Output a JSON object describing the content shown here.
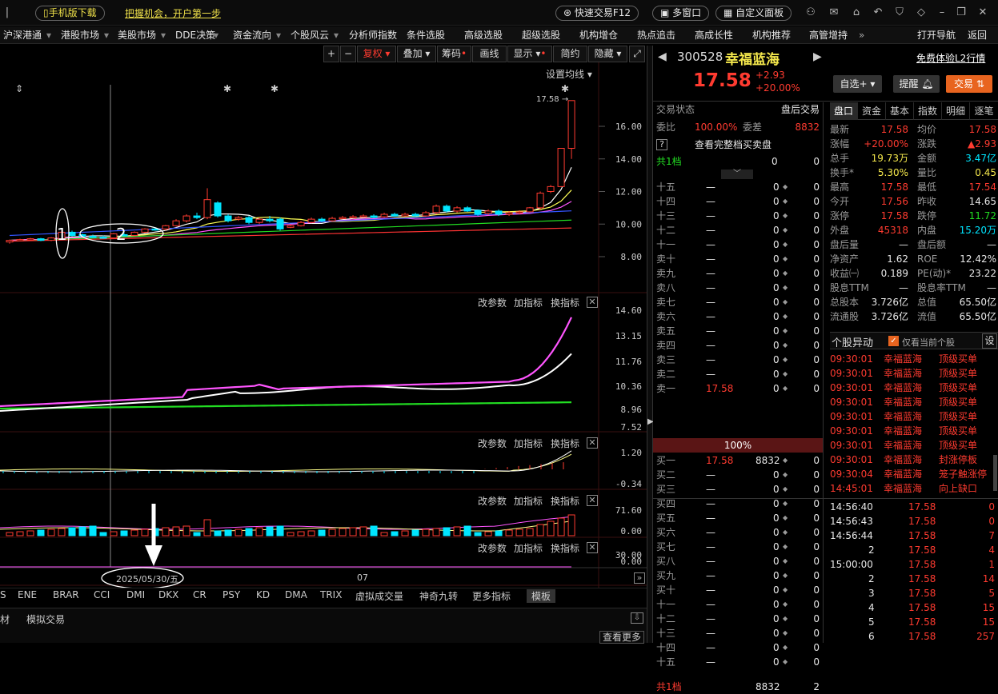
{
  "topbar": {
    "mobile": "手机版下载",
    "slogan": "把握机会，开户第一步",
    "quick_trade": "快速交易F12",
    "multi_window": "多窗口",
    "custom_panel": "自定义面板"
  },
  "menu": [
    "沪深港通",
    "港股市场",
    "美股市场",
    "DDE决策",
    "资金流向",
    "个股风云",
    "分析师指数",
    "条件选股",
    "高级选股",
    "超级选股",
    "机构增仓",
    "热点追击",
    "高成长性",
    "机构推荐",
    "高管增持"
  ],
  "menu_more": "»",
  "menu_right": [
    "打开导航",
    "返回"
  ],
  "chart_toolbar": {
    "plus": "+",
    "minus": "−",
    "fuquan": "复权",
    "overlay": "叠加",
    "chips": "筹码",
    "draw": "画线",
    "display": "显示",
    "simple": "简约",
    "hide": "隐藏"
  },
  "settings": "设置均线",
  "price_mark": "17.58",
  "annotations": {
    "one": "1",
    "two": "2"
  },
  "date_label": "2025/05/30/五",
  "month_label": "07",
  "panel_labels": {
    "params": "改参数",
    "add": "加指标",
    "switch": "换指标",
    "close": "✕"
  },
  "chart_data": [
    {
      "type": "candlestick",
      "panel": "price",
      "ylim": [
        7.5,
        17.2
      ],
      "yticks": [
        "16.00",
        "14.00",
        "12.00",
        "10.00",
        "8.00"
      ],
      "candles": [
        [
          8.9,
          9.0,
          8.8,
          9.05
        ],
        [
          9.0,
          9.05,
          8.95,
          9.1
        ],
        [
          9.05,
          9.1,
          9.0,
          9.15
        ],
        [
          9.1,
          9.0,
          8.95,
          9.15
        ],
        [
          9.0,
          9.15,
          8.95,
          9.2
        ],
        [
          9.1,
          9.5,
          9.05,
          9.6
        ],
        [
          9.5,
          9.3,
          9.25,
          9.6
        ],
        [
          9.35,
          9.25,
          9.2,
          9.4
        ],
        [
          9.25,
          9.2,
          9.15,
          9.35
        ],
        [
          9.2,
          9.15,
          9.1,
          9.3
        ],
        [
          9.15,
          9.4,
          9.1,
          9.45
        ],
        [
          9.35,
          9.3,
          9.25,
          9.45
        ],
        [
          9.3,
          9.5,
          9.25,
          9.55
        ],
        [
          9.5,
          9.7,
          9.45,
          9.75
        ],
        [
          9.7,
          9.65,
          9.6,
          9.8
        ],
        [
          9.7,
          9.9,
          9.6,
          9.95
        ],
        [
          9.9,
          10.2,
          9.85,
          10.3
        ],
        [
          10.2,
          10.5,
          10.1,
          10.6
        ],
        [
          10.5,
          10.4,
          10.3,
          10.7
        ],
        [
          10.4,
          11.5,
          10.3,
          12.2
        ],
        [
          11.3,
          10.5,
          10.4,
          11.4
        ],
        [
          10.5,
          10.2,
          10.1,
          10.6
        ],
        [
          10.3,
          10.4,
          10.2,
          10.5
        ],
        [
          10.4,
          10.1,
          10.0,
          10.5
        ],
        [
          10.1,
          10.3,
          10.0,
          10.4
        ],
        [
          10.3,
          10.2,
          10.1,
          10.5
        ],
        [
          10.3,
          9.7,
          9.6,
          10.4
        ],
        [
          9.8,
          9.9,
          9.75,
          10.0
        ],
        [
          9.9,
          10.1,
          9.85,
          10.2
        ],
        [
          10.1,
          10.3,
          10.05,
          10.4
        ],
        [
          10.3,
          10.2,
          10.1,
          10.4
        ],
        [
          10.2,
          10.35,
          10.15,
          10.45
        ],
        [
          10.35,
          10.4,
          10.3,
          10.5
        ],
        [
          10.4,
          10.45,
          10.35,
          10.55
        ],
        [
          10.45,
          10.5,
          10.4,
          10.6
        ],
        [
          10.5,
          10.4,
          10.35,
          10.6
        ],
        [
          10.45,
          10.6,
          10.4,
          10.7
        ],
        [
          10.6,
          10.5,
          10.45,
          10.7
        ],
        [
          10.5,
          10.6,
          10.45,
          10.7
        ],
        [
          10.6,
          10.5,
          10.45,
          10.7
        ],
        [
          10.5,
          10.7,
          10.45,
          10.8
        ],
        [
          10.7,
          11.1,
          10.6,
          11.2
        ],
        [
          11.1,
          10.8,
          10.7,
          11.2
        ],
        [
          10.8,
          11.0,
          10.7,
          11.1
        ],
        [
          11.0,
          10.8,
          10.75,
          11.1
        ],
        [
          10.85,
          10.6,
          10.5,
          10.9
        ],
        [
          10.65,
          10.8,
          10.55,
          10.9
        ],
        [
          10.8,
          10.6,
          10.5,
          10.9
        ],
        [
          10.6,
          10.7,
          10.5,
          10.8
        ],
        [
          10.7,
          10.75,
          10.6,
          10.85
        ],
        [
          10.75,
          11.0,
          10.7,
          11.05
        ],
        [
          11.0,
          11.9,
          10.9,
          12.0
        ],
        [
          12.0,
          12.3,
          11.9,
          12.4
        ],
        [
          12.3,
          14.65,
          12.3,
          14.65
        ],
        [
          14.65,
          17.58,
          14.0,
          17.58
        ]
      ],
      "series": [
        {
          "name": "MA5",
          "color": "#ffffff"
        },
        {
          "name": "MA10",
          "color": "#ffff55"
        },
        {
          "name": "MA20",
          "color": "#ff55ff"
        },
        {
          "name": "MA30",
          "color": "#22dd22"
        },
        {
          "name": "MA60",
          "color": "#3355ff"
        },
        {
          "name": "MA120",
          "color": "#ff3333"
        }
      ]
    },
    {
      "type": "line",
      "panel": "indicator1",
      "yticks": [
        "14.60",
        "13.15",
        "11.76",
        "10.36",
        "8.96",
        "7.52"
      ]
    },
    {
      "type": "line",
      "panel": "indicator2",
      "yticks": [
        "1.20",
        "-0.34"
      ]
    },
    {
      "type": "bar",
      "panel": "volume",
      "yticks": [
        "71.60",
        "0.00"
      ]
    },
    {
      "type": "line",
      "panel": "indicator4",
      "yticks": [
        "30.00",
        "0.00"
      ]
    }
  ],
  "index_tabs": [
    "S",
    "ENE",
    "BRAR",
    "CCI",
    "DMI",
    "DKX",
    "CR",
    "PSY",
    "KD",
    "DMA",
    "TRIX",
    "虚拟成交量",
    "神奇九转",
    "更多指标",
    "模板"
  ],
  "bottom": {
    "tab1": "材",
    "tab2": "模拟交易",
    "more": "查看更多"
  },
  "stock": {
    "code": "300528",
    "name": "幸福蓝海",
    "price": "17.58",
    "change": "+2.93",
    "pct": "+20.00%",
    "l2": "免费体验L2行情",
    "watch": "自选+",
    "remind": "提醒",
    "trade": "交易"
  },
  "status": {
    "label": "交易状态",
    "value": "盘后交易"
  },
  "weibi": {
    "l1": "委比",
    "v1": "100.00%",
    "l2": "委差",
    "v2": "8832"
  },
  "full_book": "查看完整档买卖盘",
  "gong1": {
    "label": "共1档",
    "v1": "0",
    "v2": "0"
  },
  "sells": [
    "十五",
    "十四",
    "十三",
    "十二",
    "十一",
    "卖十",
    "卖九",
    "卖八",
    "卖七",
    "卖六",
    "卖五",
    "卖四",
    "卖三",
    "卖二",
    "卖一"
  ],
  "sell1": {
    "price": "17.58",
    "vol": "0",
    "cnt": "0"
  },
  "ratio": "100%",
  "buys": [
    "买一",
    "买二",
    "买三",
    "买四",
    "买五",
    "买六",
    "买七",
    "买八",
    "买九",
    "买十",
    "十一",
    "十二",
    "十三",
    "十四",
    "十五"
  ],
  "buy1": {
    "price": "17.58",
    "vol": "8832",
    "cnt": "0"
  },
  "dash": "—",
  "zero": "0",
  "bottom_gong": {
    "label": "共1档",
    "v1": "8832",
    "v2": "2"
  },
  "tabs": [
    "盘口",
    "资金",
    "基本",
    "指数",
    "明细",
    "逐笔"
  ],
  "quote": [
    [
      "最新",
      "17.58",
      "均价",
      "17.58"
    ],
    [
      "涨幅",
      "+20.00%",
      "涨跌",
      "▲2.93"
    ],
    [
      "总手",
      "19.73万",
      "金额",
      "3.47亿"
    ],
    [
      "换手*",
      "5.30%",
      "量比",
      "0.45"
    ],
    [
      "最高",
      "17.58",
      "最低",
      "17.54"
    ],
    [
      "今开",
      "17.56",
      "昨收",
      "14.65"
    ],
    [
      "涨停",
      "17.58",
      "跌停",
      "11.72"
    ],
    [
      "外盘",
      "45318",
      "内盘",
      "15.20万"
    ],
    [
      "盘后量",
      "—",
      "盘后额",
      "—"
    ],
    [
      "净资产",
      "1.62",
      "ROE",
      "12.42%"
    ],
    [
      "收益㈠",
      "0.189",
      "PE(动)*",
      "23.22"
    ],
    [
      "股息TTM",
      "—",
      "股息率TTM",
      "—"
    ],
    [
      "总股本",
      "3.726亿",
      "总值",
      "65.50亿"
    ],
    [
      "流通股",
      "3.726亿",
      "流值",
      "65.50亿"
    ]
  ],
  "events_header": {
    "title": "个股异动",
    "check": "仅看当前个股",
    "set": "设"
  },
  "events": [
    [
      "09:30:01",
      "幸福蓝海",
      "顶级买单"
    ],
    [
      "09:30:01",
      "幸福蓝海",
      "顶级买单"
    ],
    [
      "09:30:01",
      "幸福蓝海",
      "顶级买单"
    ],
    [
      "09:30:01",
      "幸福蓝海",
      "顶级买单"
    ],
    [
      "09:30:01",
      "幸福蓝海",
      "顶级买单"
    ],
    [
      "09:30:01",
      "幸福蓝海",
      "顶级买单"
    ],
    [
      "09:30:01",
      "幸福蓝海",
      "顶级买单"
    ],
    [
      "09:30:01",
      "幸福蓝海",
      "封涨停板"
    ],
    [
      "09:30:04",
      "幸福蓝海",
      "笼子触涨停"
    ],
    [
      "14:45:01",
      "幸福蓝海",
      "向上缺口"
    ]
  ],
  "ticks": [
    [
      "14:56:40",
      "17.58",
      "0"
    ],
    [
      "14:56:43",
      "17.58",
      "0"
    ],
    [
      "14:56:44",
      "17.58",
      "7"
    ],
    [
      "2",
      "17.58",
      "4"
    ],
    [
      "15:00:00",
      "17.58",
      "1"
    ],
    [
      "2",
      "17.58",
      "14"
    ],
    [
      "3",
      "17.58",
      "5"
    ],
    [
      "4",
      "17.58",
      "15"
    ],
    [
      "5",
      "17.58",
      "15"
    ],
    [
      "6",
      "17.58",
      "257"
    ]
  ],
  "colors": {
    "up": "#ff3b30",
    "down": "#00e5ff",
    "accent": "#f0e24a"
  }
}
